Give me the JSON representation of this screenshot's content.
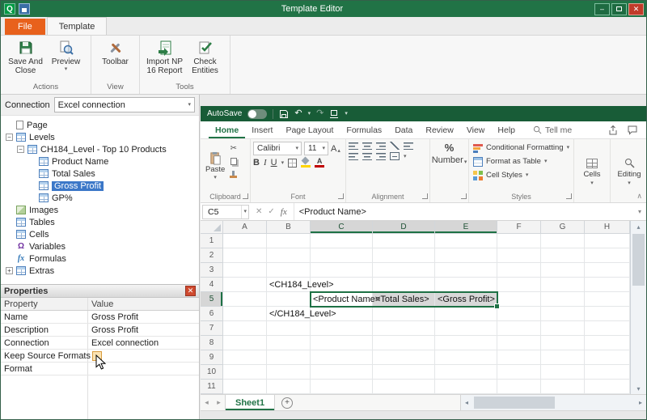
{
  "icons": {
    "app_logo": "Q",
    "minimize": "–",
    "close": "✕",
    "dropdown": "▾",
    "up_small": "▴",
    "scissors": "✂",
    "undo": "↶",
    "redo": "↷",
    "cancel": "✕",
    "check": "✓",
    "fx": "fx",
    "omega": "Ω",
    "collapse_minus": "−",
    "expand_plus": "+",
    "nav_left": "◂",
    "nav_right": "▸",
    "scroll_up": "▴",
    "scroll_down": "▾",
    "add_sheet": "+",
    "percent": "%",
    "bold": "B",
    "italic": "I",
    "underline": "U",
    "font_letter": "A",
    "collapse_ribbon": "∧"
  },
  "window": {
    "title": "Template Editor"
  },
  "app_ribbon": {
    "file_tab": "File",
    "template_tab": "Template",
    "groups": [
      {
        "label": "Actions",
        "buttons": [
          {
            "label": "Save And Close"
          },
          {
            "label": "Preview"
          }
        ]
      },
      {
        "label": "View",
        "buttons": [
          {
            "label": "Toolbar"
          }
        ]
      },
      {
        "label": "Tools",
        "buttons": [
          {
            "label": "Import NP 16 Report"
          },
          {
            "label": "Check Entities"
          }
        ]
      }
    ]
  },
  "left_panel": {
    "connection": {
      "label": "Connection",
      "value": "Excel connection"
    },
    "tree": {
      "items": [
        {
          "label": "Page"
        },
        {
          "label": "Levels"
        },
        {
          "label": "CH184_Level - Top 10 Products"
        },
        {
          "label": "Product Name"
        },
        {
          "label": "Total Sales"
        },
        {
          "label": "Gross Profit"
        },
        {
          "label": "GP%"
        },
        {
          "label": "Images"
        },
        {
          "label": "Tables"
        },
        {
          "label": "Cells"
        },
        {
          "label": "Variables"
        },
        {
          "label": "Formulas"
        },
        {
          "label": "Extras"
        }
      ]
    },
    "properties": {
      "title": "Properties",
      "columns": [
        "Property",
        "Value"
      ],
      "rows": [
        {
          "property": "Name",
          "value": "Gross Profit"
        },
        {
          "property": "Description",
          "value": "Gross Profit"
        },
        {
          "property": "Connection",
          "value": "Excel connection"
        },
        {
          "property": "Keep Source Formats",
          "value": ""
        },
        {
          "property": "Format",
          "value": ""
        }
      ]
    }
  },
  "excel": {
    "quick_access": {
      "autosave_label": "AutoSave"
    },
    "tabs": [
      "Home",
      "Insert",
      "Page Layout",
      "Formulas",
      "Data",
      "Review",
      "View",
      "Help"
    ],
    "tell_me": "Tell me",
    "ribbon": {
      "paste": "Paste",
      "font_name": "Calibri",
      "font_size": "11",
      "number_label": "Number",
      "styles_buttons": [
        "Conditional Formatting",
        "Format as Table",
        "Cell Styles"
      ],
      "cells_label": "Cells",
      "editing_label": "Editing",
      "group_labels": {
        "clipboard": "Clipboard",
        "font": "Font",
        "alignment": "Alignment",
        "styles": "Styles"
      }
    },
    "formula_bar": {
      "name_box": "C5",
      "formula": "<Product Name>"
    },
    "grid": {
      "columns": [
        "A",
        "B",
        "C",
        "D",
        "E",
        "F",
        "G",
        "H"
      ],
      "row_labels": [
        "1",
        "2",
        "3",
        "4",
        "5",
        "6",
        "7",
        "8",
        "9",
        "10",
        "11"
      ],
      "cells": {
        "B4": "<CH184_Level>",
        "C5": "<Product Name>",
        "D5": "<Total Sales>",
        "E5": "<Gross Profit>",
        "B6": "</CH184_Level>"
      },
      "active_cell": "C5",
      "shaded_cells": [
        "D5",
        "E5"
      ],
      "selected_columns": [
        "C",
        "D",
        "E"
      ],
      "selected_rows": [
        "5"
      ]
    },
    "sheet_bar": {
      "sheets": [
        "Sheet1"
      ]
    }
  }
}
